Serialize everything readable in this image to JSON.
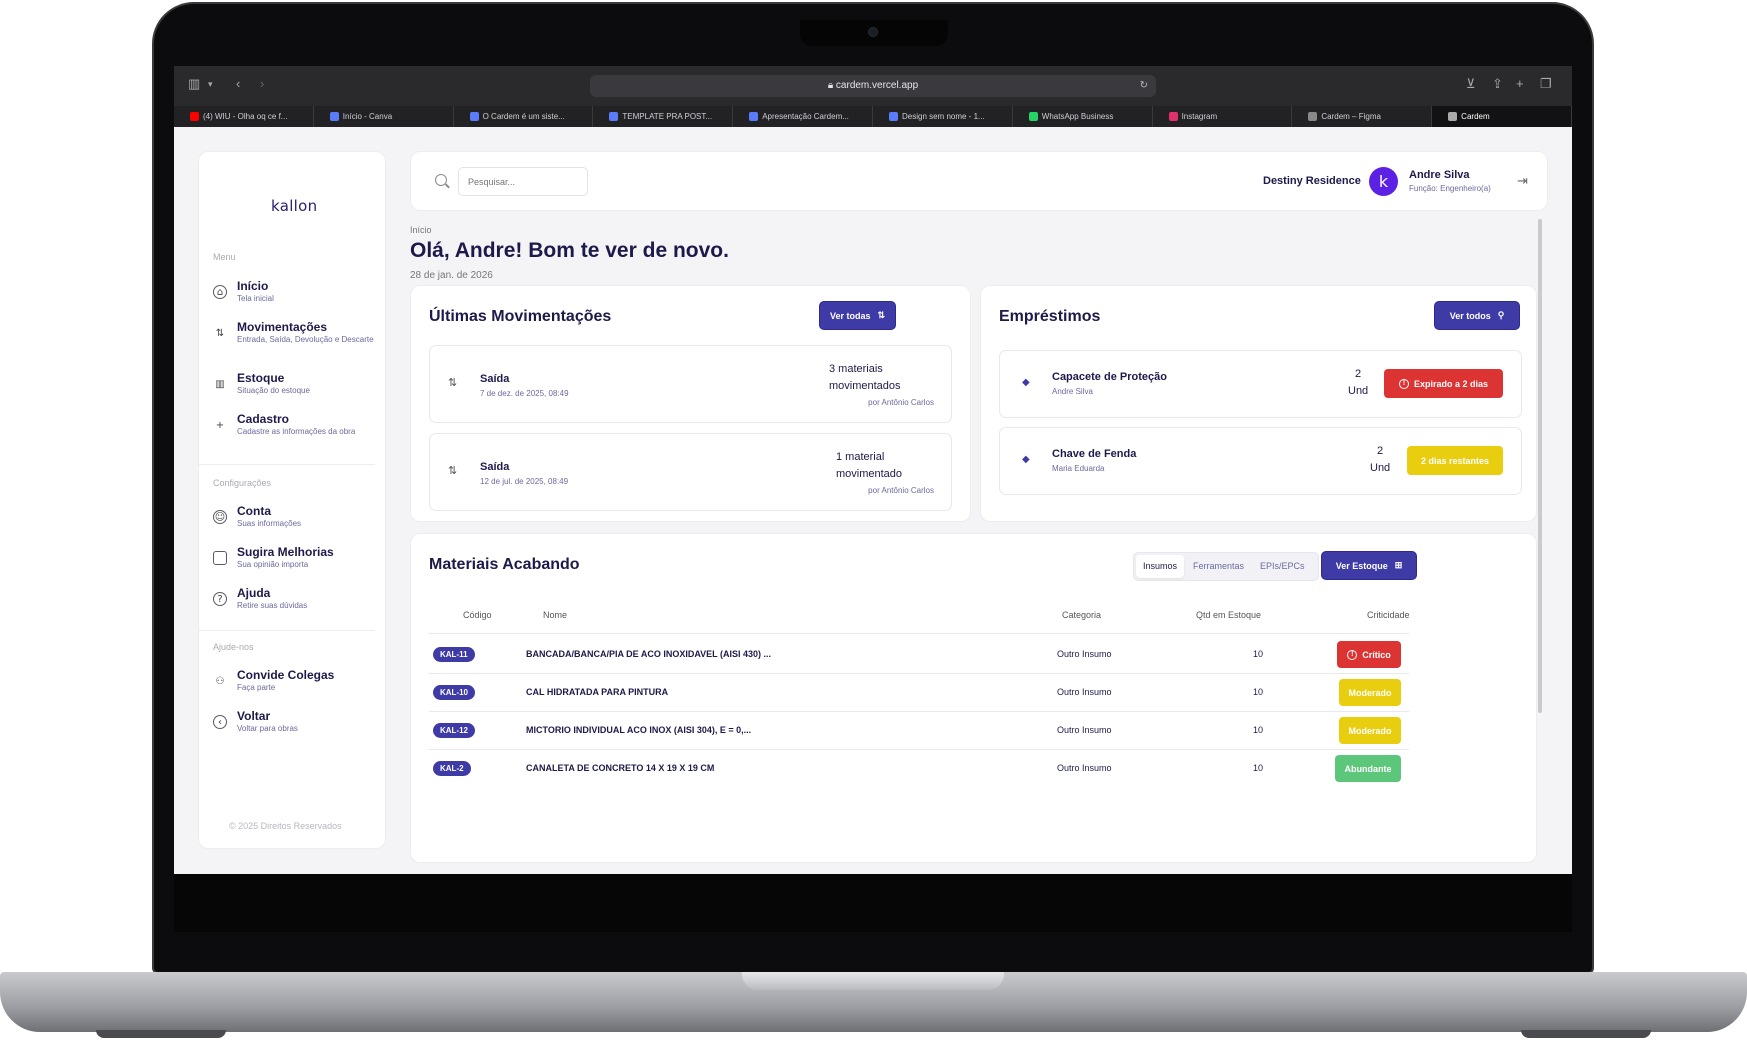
{
  "browser": {
    "url": "cardem.vercel.app",
    "tabs": [
      {
        "label": "(4) WIU - Olha oq ce f...",
        "color": "#ff0000"
      },
      {
        "label": "Início - Canva",
        "color": "#5b7cfa"
      },
      {
        "label": "O Cardem é um siste...",
        "color": "#5b7cfa"
      },
      {
        "label": "TEMPLATE PRA POST...",
        "color": "#5b7cfa"
      },
      {
        "label": "Apresentação Cardem...",
        "color": "#5b7cfa"
      },
      {
        "label": "Design sem nome - 1...",
        "color": "#5b7cfa"
      },
      {
        "label": "WhatsApp Business",
        "color": "#25d366"
      },
      {
        "label": "Instagram",
        "color": "#e1306c"
      },
      {
        "label": "Cardem – Figma",
        "color": "#888888"
      },
      {
        "label": "Cardem",
        "color": "#aaaaaa"
      }
    ]
  },
  "sidebar": {
    "logo": "kallon",
    "menu_label": "Menu",
    "menu": [
      {
        "title": "Início",
        "sub": "Tela inicial",
        "icon": "home-icon"
      },
      {
        "title": "Movimentações",
        "sub": "Entrada, Saída, Devolução e Descarte",
        "icon": "arrows-icon"
      },
      {
        "title": "Estoque",
        "sub": "Situação do estoque",
        "icon": "chart-icon"
      },
      {
        "title": "Cadastro",
        "sub": "Cadastre as informações da obra",
        "icon": "plus-icon"
      }
    ],
    "config_label": "Configurações",
    "config": [
      {
        "title": "Conta",
        "sub": "Suas informações",
        "icon": "user-icon"
      },
      {
        "title": "Sugira Melhorias",
        "sub": "Sua opinião importa",
        "icon": "chat-icon"
      },
      {
        "title": "Ajuda",
        "sub": "Retire suas dúvidas",
        "icon": "help-icon"
      }
    ],
    "help_label": "Ajude-nos",
    "help": [
      {
        "title": "Convide Colegas",
        "sub": "Faça parte",
        "icon": "people-icon"
      },
      {
        "title": "Voltar",
        "sub": "Voltar para obras",
        "icon": "back-icon"
      }
    ],
    "copyright": "© 2025 Direitos Reservados"
  },
  "header": {
    "search_placeholder": "Pesquisar...",
    "project": "Destiny Residence",
    "avatar_letter": "k",
    "user_name": "Andre Silva",
    "user_role": "Função: Engenheiro(a)"
  },
  "page": {
    "breadcrumb": "Início",
    "greeting": "Olá, Andre! Bom te ver de novo.",
    "date": "28 de jan. de 2026"
  },
  "movements": {
    "title": "Últimas Movimentações",
    "button": "Ver todas",
    "items": [
      {
        "type": "Saída",
        "date": "7 de dez. de 2025, 08:49",
        "count": "3 materiais movimentados",
        "by": "por Antônio Carlos"
      },
      {
        "type": "Saída",
        "date": "12 de jul. de 2025, 08:49",
        "count": "1 material movimentado",
        "by": "por Antônio Carlos"
      }
    ]
  },
  "loans": {
    "title": "Empréstimos",
    "button": "Ver todos",
    "items": [
      {
        "name": "Capacete de Proteção",
        "user": "Andre Silva",
        "qty": "2",
        "unit": "Und",
        "status": "Expirado a 2 dias",
        "status_color": "red"
      },
      {
        "name": "Chave de Fenda",
        "user": "Maria Eduarda",
        "qty": "2",
        "unit": "Und",
        "status": "2 dias restantes",
        "status_color": "yellow"
      }
    ]
  },
  "materials": {
    "title": "Materiais Acabando",
    "tabs": [
      "Insumos",
      "Ferramentas",
      "EPIs/EPCs"
    ],
    "active_tab": "Insumos",
    "button": "Ver Estoque",
    "columns": [
      "Código",
      "Nome",
      "Categoria",
      "Qtd em Estoque",
      "Criticidade"
    ],
    "rows": [
      {
        "code": "KAL-11",
        "name": "BANCADA/BANCA/PIA DE ACO INOXIDAVEL (AISI 430) ...",
        "category": "Outro Insumo",
        "qty": "10",
        "level": "Crítico",
        "level_color": "red"
      },
      {
        "code": "KAL-10",
        "name": "CAL HIDRATADA PARA PINTURA",
        "category": "Outro Insumo",
        "qty": "10",
        "level": "Moderado",
        "level_color": "yellow"
      },
      {
        "code": "KAL-12",
        "name": "MICTORIO INDIVIDUAL ACO INOX (AISI 304), E = 0,...",
        "category": "Outro Insumo",
        "qty": "10",
        "level": "Moderado",
        "level_color": "yellow"
      },
      {
        "code": "KAL-2",
        "name": "CANALETA DE CONCRETO 14 X 19 X 19 CM",
        "category": "Outro Insumo",
        "qty": "10",
        "level": "Abundante",
        "level_color": "green"
      }
    ]
  }
}
